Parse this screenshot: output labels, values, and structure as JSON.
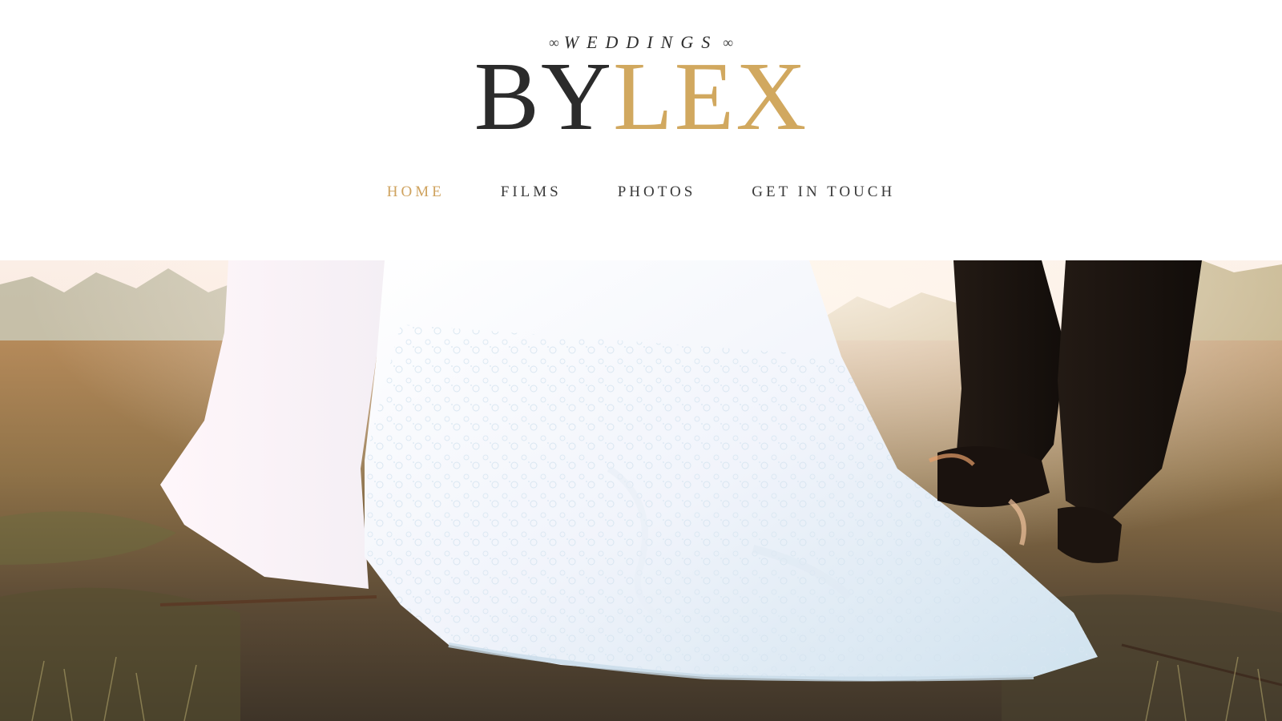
{
  "brand": {
    "tagline_prefix": "∞",
    "tagline": "WEDDINGS",
    "tagline_suffix": "∞",
    "name_part1": "BY",
    "name_part2": "LEX",
    "accent_color": "#d1a85f",
    "dark_color": "#2b2b2b"
  },
  "nav": {
    "items": [
      {
        "label": "HOME",
        "active": true
      },
      {
        "label": "FILMS",
        "active": false
      },
      {
        "label": "PHOTOS",
        "active": false
      },
      {
        "label": "GET IN TOUCH",
        "active": false
      }
    ]
  },
  "hero": {
    "subject": "bride-and-groom-walking-on-grass"
  }
}
